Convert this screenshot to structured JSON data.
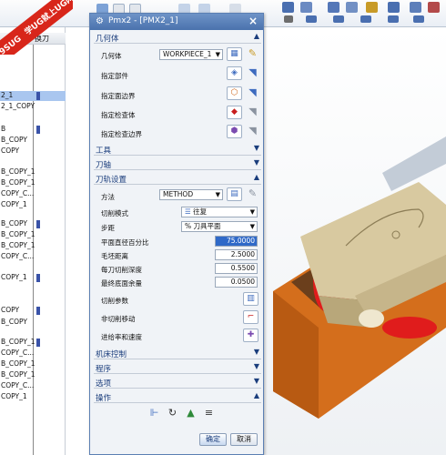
{
  "watermark": {
    "line1": "9SUG",
    "line2": "学UG就上UG网"
  },
  "navigator": {
    "column_header": "换刀",
    "rows": [
      {
        "label": "2_1",
        "flag": true,
        "selected": true
      },
      {
        "label": "2_1_COPY",
        "flag": false,
        "selected": false
      },
      {
        "label": "B",
        "flag": true,
        "selected": false
      },
      {
        "label": "B_COPY",
        "flag": false,
        "selected": false
      },
      {
        "label": "COPY",
        "flag": false,
        "selected": false
      },
      {
        "label": "B_COPY_1",
        "flag": false,
        "selected": false
      },
      {
        "label": "B_COPY_1",
        "flag": false,
        "selected": false
      },
      {
        "label": "COPY_C...",
        "flag": false,
        "selected": false
      },
      {
        "label": "COPY_1",
        "flag": false,
        "selected": false
      },
      {
        "label": "B_COPY",
        "flag": true,
        "selected": false
      },
      {
        "label": "B_COPY_1",
        "flag": false,
        "selected": false
      },
      {
        "label": "B_COPY_1",
        "flag": false,
        "selected": false
      },
      {
        "label": "COPY_C...",
        "flag": false,
        "selected": false
      },
      {
        "label": "COPY_1",
        "flag": true,
        "selected": false
      },
      {
        "label": "COPY",
        "flag": true,
        "selected": false
      },
      {
        "label": "B_COPY",
        "flag": false,
        "selected": false
      },
      {
        "label": "B_COPY_1",
        "flag": true,
        "selected": false
      },
      {
        "label": "COPY_C...",
        "flag": false,
        "selected": false
      },
      {
        "label": "B_COPY_1",
        "flag": false,
        "selected": false
      },
      {
        "label": "B_COPY_1",
        "flag": false,
        "selected": false
      },
      {
        "label": "COPY_C...",
        "flag": false,
        "selected": false
      },
      {
        "label": "COPY_1",
        "flag": false,
        "selected": false
      }
    ]
  },
  "dialog": {
    "title": "Pmx2 - [PMX2_1]",
    "sections": {
      "geometry": "几何体",
      "tool": "工具",
      "tool_axis": "刀轴",
      "path_settings": "刀轨设置",
      "machine_control": "机床控制",
      "program": "程序",
      "options": "选项",
      "actions": "操作"
    },
    "geometry": {
      "label": "几何体",
      "value": "WORKPIECE_1",
      "specify_part": "指定部件",
      "specify_face_boundary": "指定面边界",
      "specify_check_body": "指定检查体",
      "specify_check_boundary": "指定检查边界"
    },
    "path": {
      "method_label": "方法",
      "method_value": "METHOD",
      "cut_pattern_label": "切削模式",
      "cut_pattern_value": "往复",
      "stepover_label": "步距",
      "stepover_value": "% 刀具平面",
      "percent_label": "平面直径百分比",
      "percent_value": "75.0000",
      "blank_distance_label": "毛坯距离",
      "blank_distance_value": "2.5000",
      "depth_per_cut_label": "每刀切削深度",
      "depth_per_cut_value": "0.5500",
      "final_floor_stock_label": "最终底面余量",
      "final_floor_stock_value": "0.0500",
      "cut_params_label": "切削参数",
      "non_cutting_label": "非切削移动",
      "feeds_speeds_label": "进给率和速度"
    },
    "buttons": {
      "ok": "确定",
      "cancel": "取消"
    }
  }
}
